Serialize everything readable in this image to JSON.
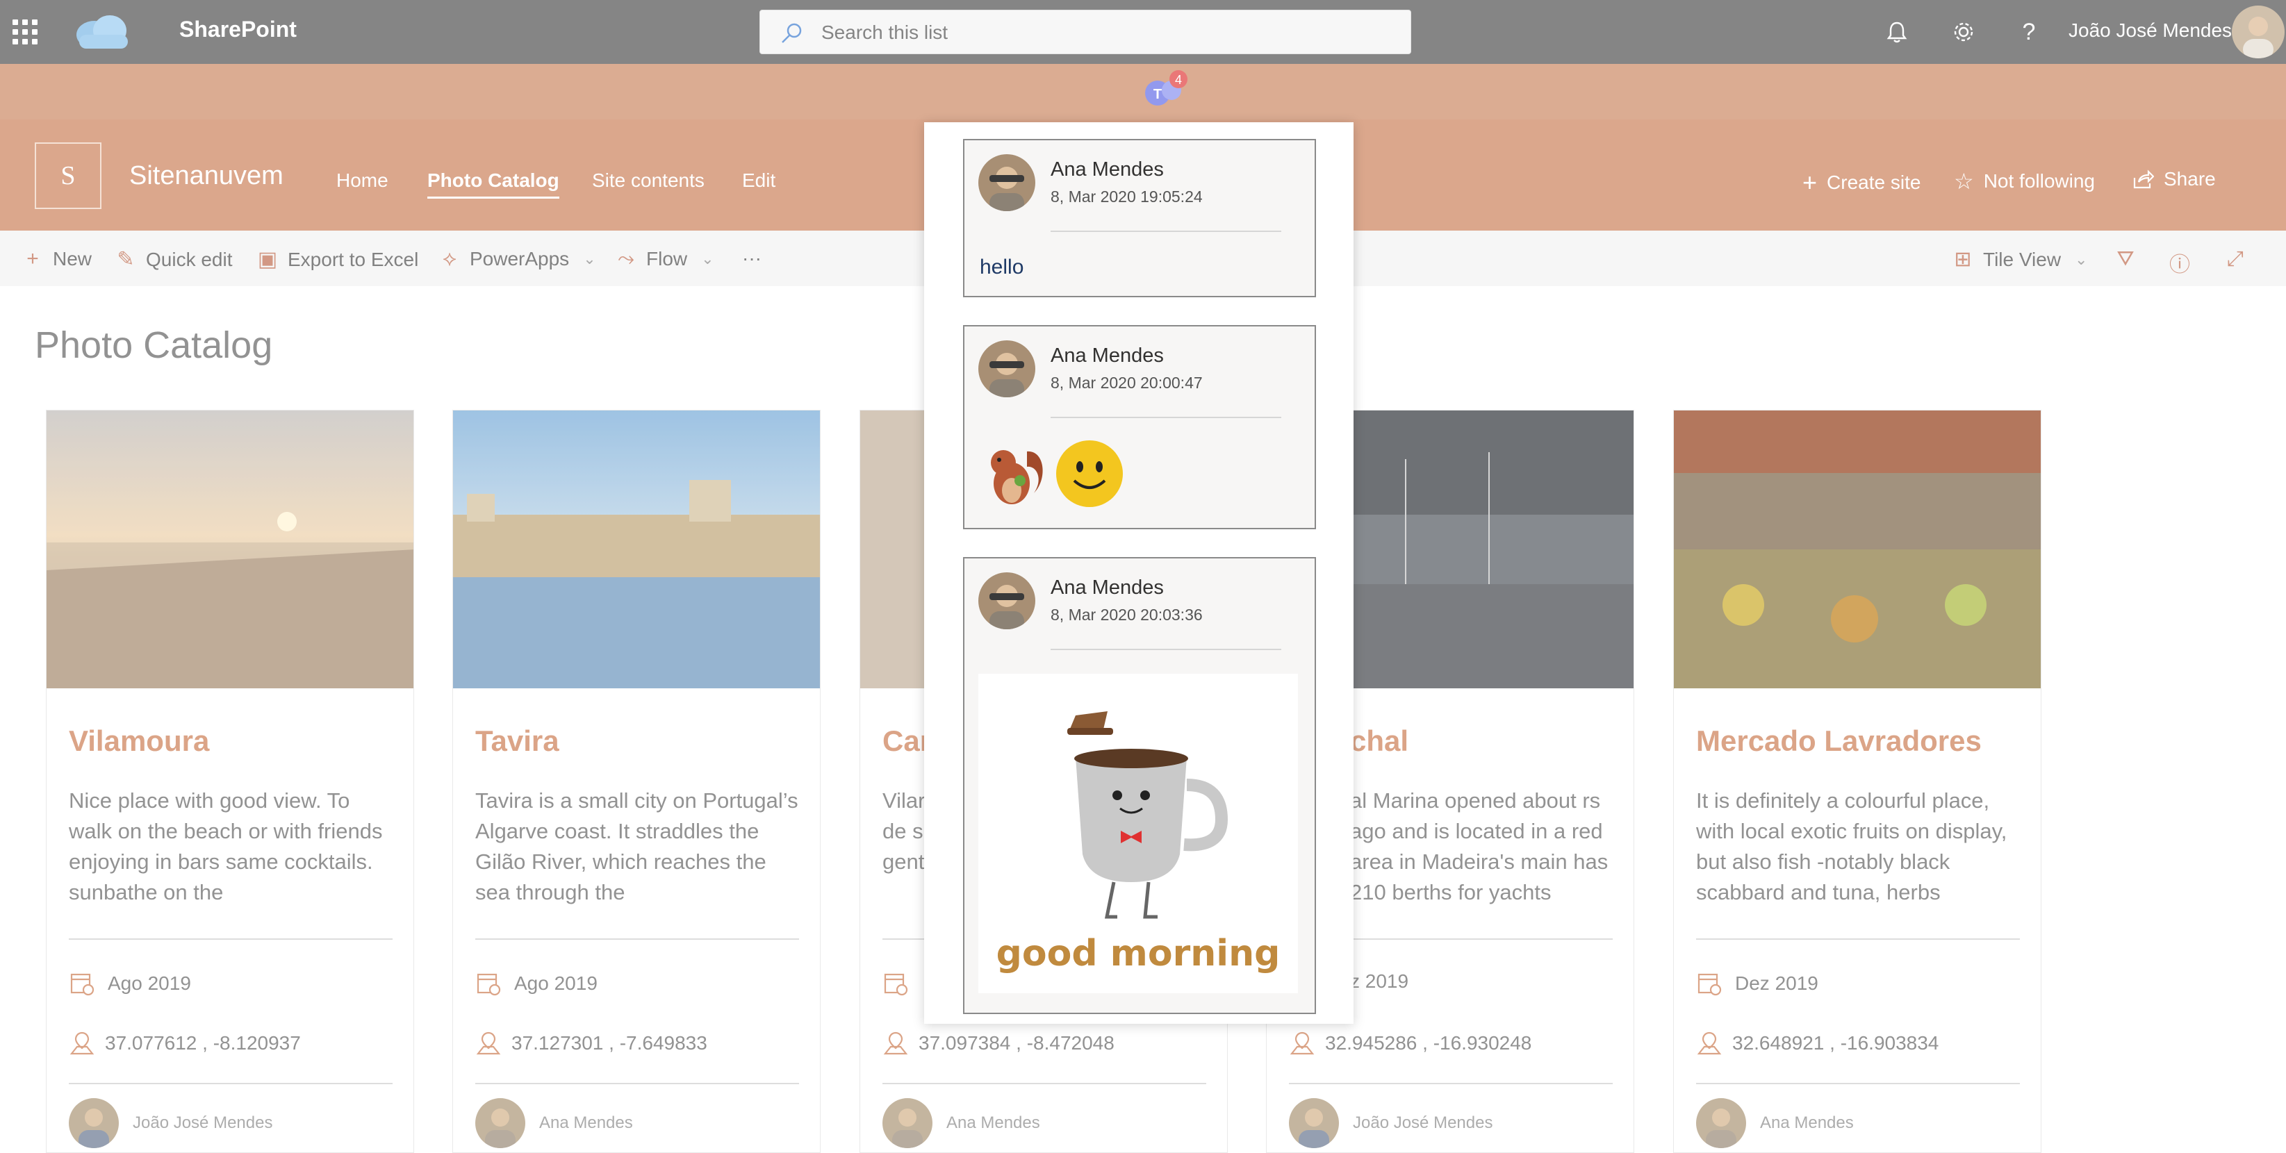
{
  "suitebar": {
    "app_name": "SharePoint",
    "search_placeholder": "Search this list",
    "user_name": "João José Mendes",
    "icons": [
      "waffle-icon",
      "notifications-icon",
      "settings-icon",
      "help-icon"
    ]
  },
  "teams": {
    "badge_count": "4"
  },
  "site": {
    "logo_letter": "S",
    "name": "Sitenanuvem",
    "nav": [
      {
        "label": "Home",
        "active": false
      },
      {
        "label": "Photo Catalog",
        "active": true
      },
      {
        "label": "Site contents",
        "active": false
      },
      {
        "label": "Edit",
        "active": false
      }
    ],
    "actions": {
      "create_site": "Create site",
      "not_following": "Not following",
      "share": "Share"
    }
  },
  "commandbar": {
    "new": "New",
    "quick_edit": "Quick edit",
    "export": "Export to Excel",
    "powerapps": "PowerApps",
    "flow": "Flow",
    "more": "···",
    "view": "Tile View"
  },
  "page": {
    "title": "Photo Catalog"
  },
  "cards": [
    {
      "title": "Vilamoura",
      "desc": "Nice place with good view. To walk on the beach or with friends enjoying in bars same cocktails. sunbathe on the",
      "date": "Ago 2019",
      "coords": "37.077612 , -8.120937",
      "author": "João José Mendes"
    },
    {
      "title": "Tavira",
      "desc": "Tavira is a small city on Portugal’s Algarve coast. It straddles the Gilão River, which reaches the sea through the",
      "date": "Ago 2019",
      "coords": "37.127301 , -7.649833",
      "author": "Ana Mendes"
    },
    {
      "title": "Car",
      "desc": "Vilar de s gent",
      "date": "",
      "coords": "37.097384 , -8.472048",
      "author": "Ana Mendes"
    },
    {
      "title": "chal",
      "desc": "al Marina opened about rs ago and is located in a red area in Madeira's main has 210 berths for yachts",
      "date": "z 2019",
      "coords": "32.945286 , -16.930248",
      "author": "João José Mendes"
    },
    {
      "title": "Mercado Lavradores",
      "desc": "It is definitely a colourful place, with local exotic fruits on display, but also fish -notably black scabbard and tuna, herbs",
      "date": "Dez 2019",
      "coords": "32.648921 , -16.903834",
      "author": "Ana Mendes"
    }
  ],
  "chat": {
    "messages": [
      {
        "author": "Ana Mendes",
        "time": "8, Mar 2020 19:05:24",
        "text": "hello"
      },
      {
        "author": "Ana Mendes",
        "time": "8, Mar 2020 20:00:47",
        "text": ""
      },
      {
        "author": "Ana Mendes",
        "time": "8, Mar 2020 20:03:36",
        "text": ""
      }
    ],
    "gif_caption": "good morning"
  },
  "colors": {
    "accent": "#d4906d",
    "header": "#d49473",
    "suitebar": "#6b6b6b"
  }
}
